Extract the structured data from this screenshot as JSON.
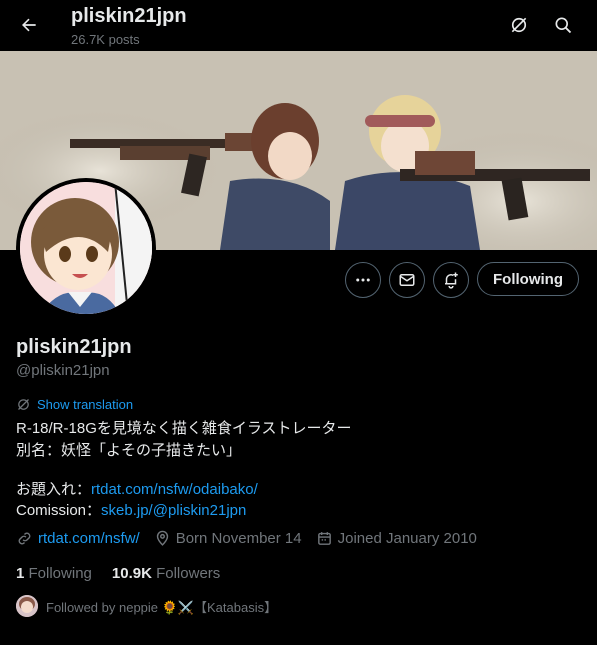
{
  "header": {
    "title": "pliskin21jpn",
    "subtitle": "26.7K posts"
  },
  "profile": {
    "display_name": "pliskin21jpn",
    "handle": "@pliskin21jpn",
    "show_translation": "Show translation",
    "bio_line1": "R-18/R-18Gを見境なく描く雑食イラストレーター",
    "bio_line2": "別名：妖怪「よその子描きたい」",
    "odai_label": "お題入れ：",
    "odai_link": "rtdat.com/nsfw/odaibako/",
    "comission_label": "Comission：",
    "comission_link": "skeb.jp/@pliskin21jpn",
    "website": "rtdat.com/nsfw/",
    "born": "Born November 14",
    "joined": "Joined January 2010",
    "following_count": "1",
    "following_label": "Following",
    "followers_count": "10.9K",
    "followers_label": "Followers",
    "followed_by": "Followed by neppie 🌻⚔️【Katabasis】"
  },
  "buttons": {
    "following": "Following"
  },
  "icons": {
    "back": "arrow-left-icon",
    "translate_header": "translate-icon",
    "search": "search-icon",
    "more": "more-dots-icon",
    "message": "mail-icon",
    "notify": "bell-plus-icon",
    "link": "link-icon",
    "location": "location-pin-icon",
    "calendar": "calendar-icon"
  },
  "colors": {
    "accent": "#1d9bf0",
    "muted": "#71767b",
    "text": "#e7e9ea",
    "background": "#000000"
  }
}
